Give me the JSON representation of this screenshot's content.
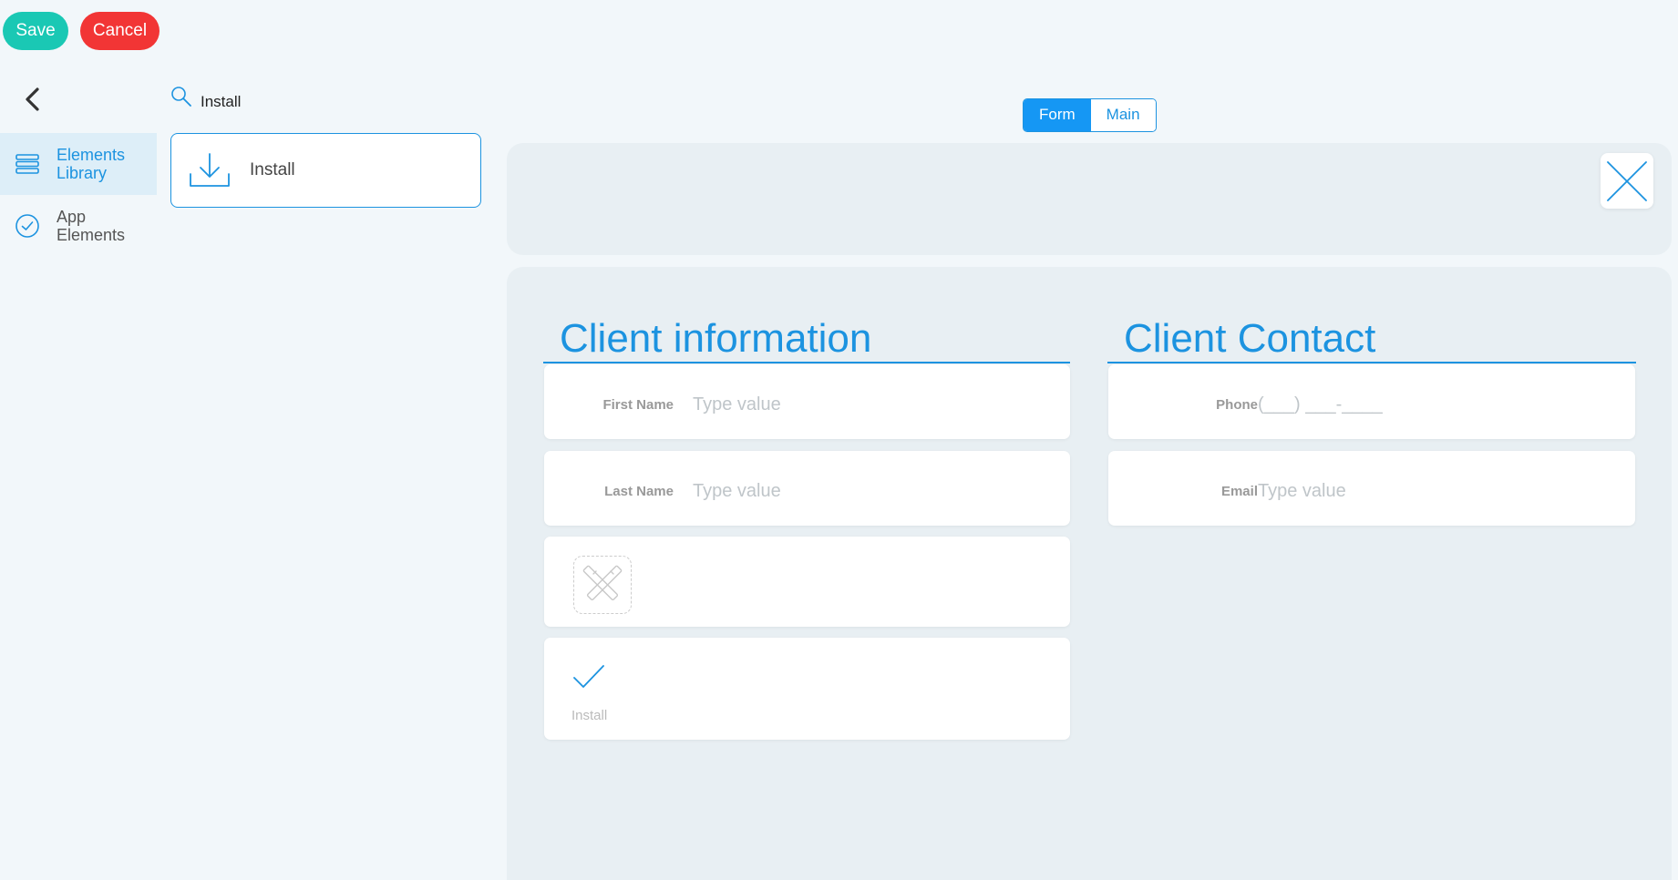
{
  "toolbar": {
    "save_label": "Save",
    "cancel_label": "Cancel"
  },
  "sidebar": {
    "items": [
      {
        "label_line1": "Elements",
        "label_line2": "Library",
        "icon": "stacked-layers-icon",
        "active": true
      },
      {
        "label_line1": "App",
        "label_line2": "Elements",
        "icon": "check-circle-icon",
        "active": false
      }
    ]
  },
  "search": {
    "value": "Install"
  },
  "library": {
    "results": [
      {
        "label": "Install",
        "icon": "download-icon"
      }
    ]
  },
  "tabs": [
    {
      "label": "Form",
      "active": true
    },
    {
      "label": "Main",
      "active": false
    }
  ],
  "form": {
    "client_information": {
      "title": "Client information",
      "fields": [
        {
          "label": "First Name",
          "placeholder": "Type value"
        },
        {
          "label": "Last Name",
          "placeholder": "Type value"
        }
      ],
      "image_placeholder_icon": "design-tools-icon",
      "checkbox": {
        "caption": "Install",
        "checked": true
      }
    },
    "client_contact": {
      "title": "Client Contact",
      "fields": [
        {
          "label": "Phone",
          "placeholder": "(___) ___-____"
        },
        {
          "label": "Email",
          "placeholder": "Type value"
        }
      ]
    }
  },
  "colors": {
    "accent": "#1c93e0",
    "save": "#1ac8b4",
    "cancel": "#f23535",
    "panel": "#e8eff3",
    "background": "#f2f7fa"
  }
}
